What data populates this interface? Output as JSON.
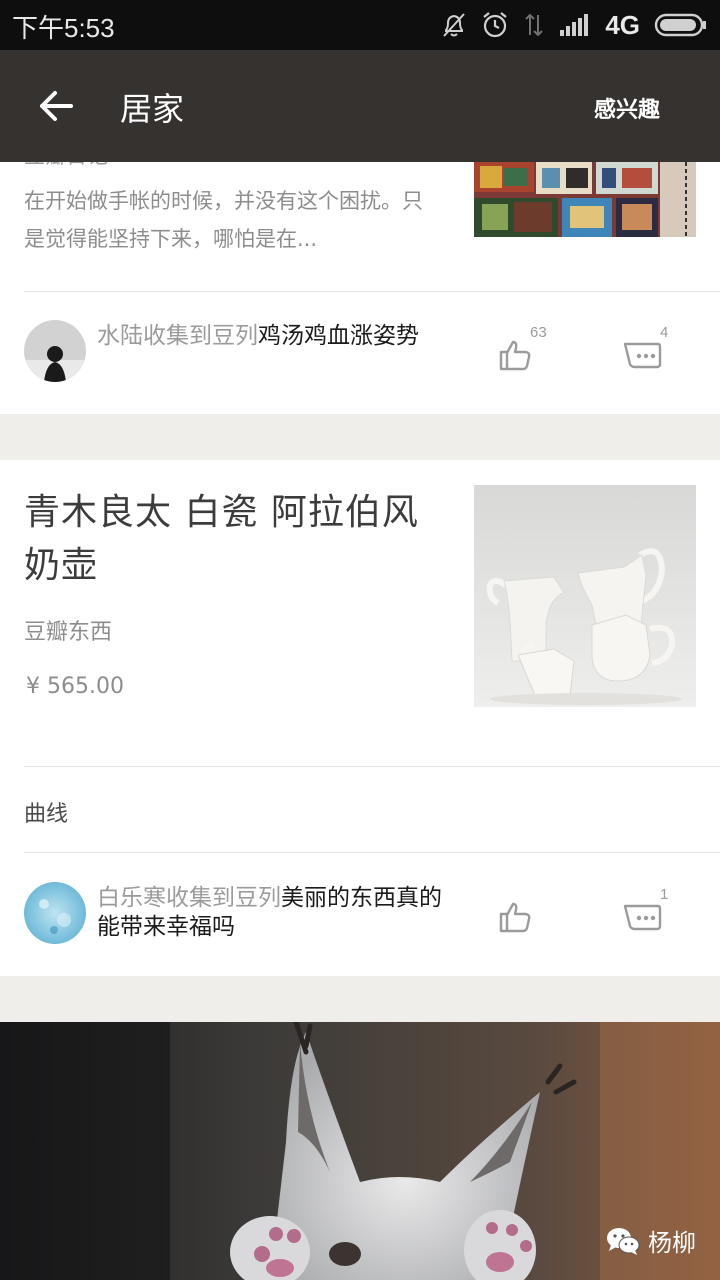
{
  "status_bar": {
    "time": "下午5:53",
    "network": "4G"
  },
  "toolbar": {
    "back_icon": "arrow-left-icon",
    "title": "居家",
    "action": "感兴趣"
  },
  "cards": [
    {
      "clipped_source": "豆瓣日记",
      "snippet": "在开始做手帐的时候，并没有这个困扰。只是觉得能坚持下来，哪怕是在...",
      "collector": "水陆",
      "collect_phrase": "收集到豆列",
      "list_name": "鸡汤鸡血涨姿势",
      "likes": "63",
      "comments": "4"
    },
    {
      "title": "青木良太 白瓷 阿拉伯风奶壶",
      "source": "豆瓣东西",
      "price": "¥ 565.00",
      "tag": "曲线",
      "collector": "白乐寒",
      "collect_phrase": "收集到豆列",
      "list_name": "美丽的东西真的能带来幸福吗",
      "likes": "",
      "comments": "1"
    }
  ],
  "watermark": {
    "icon": "wechat-icon",
    "text": "杨柳"
  },
  "colors": {
    "status_bar_bg": "#0e0e0e",
    "toolbar_bg": "#353230",
    "page_bg": "#efeeeb",
    "card_bg": "#ffffff",
    "muted_text": "#9b9b9b"
  }
}
